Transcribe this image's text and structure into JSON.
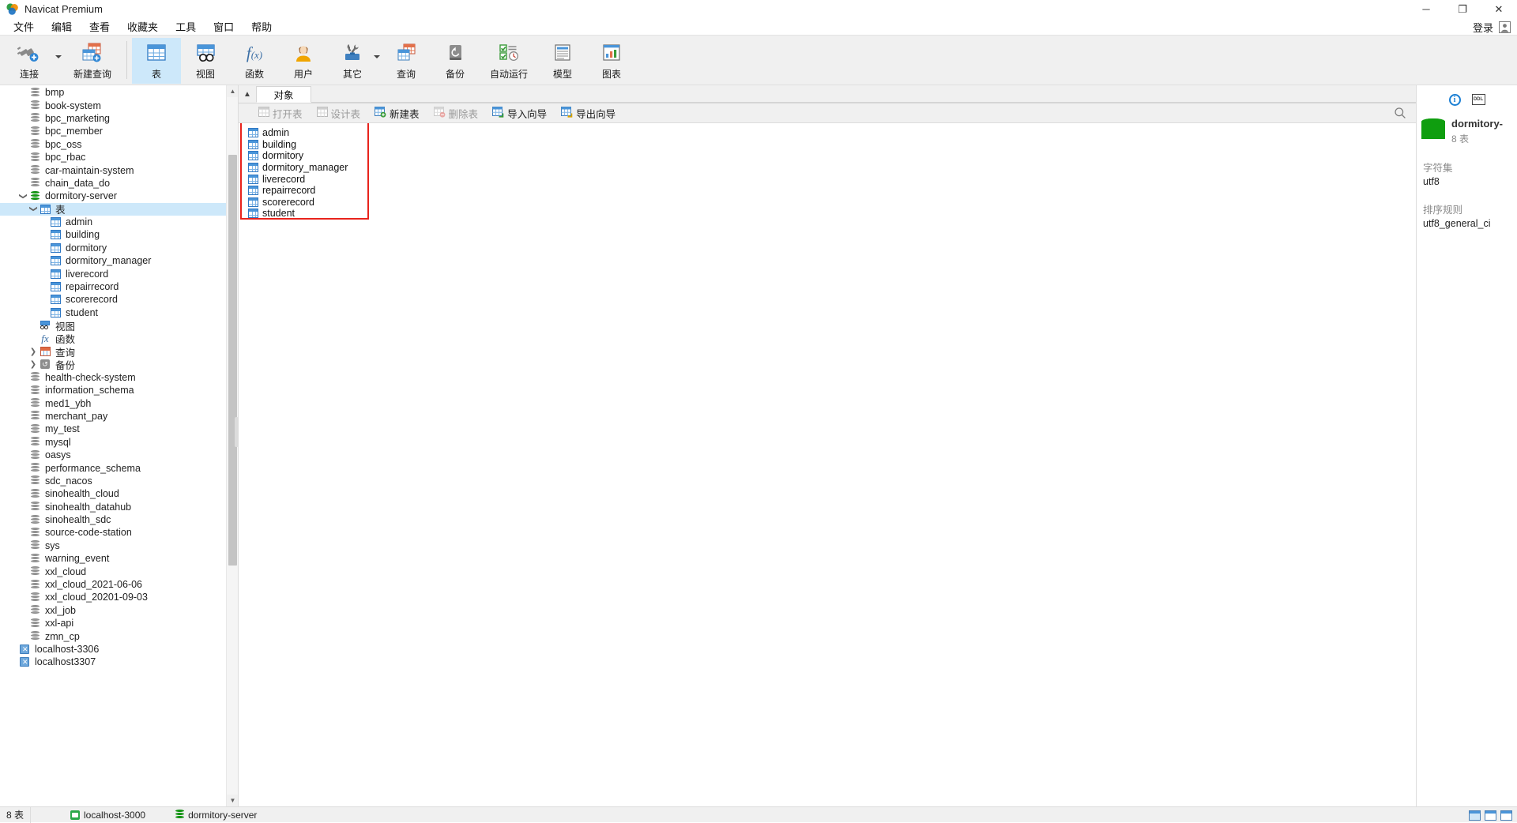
{
  "window": {
    "title": "Navicat Premium",
    "buttons": {
      "minimize": "─",
      "maximize": "❐",
      "close": "✕"
    }
  },
  "menu": {
    "items": [
      {
        "label": "文件"
      },
      {
        "label": "编辑"
      },
      {
        "label": "查看"
      },
      {
        "label": "收藏夹"
      },
      {
        "label": "工具"
      },
      {
        "label": "窗口"
      },
      {
        "label": "帮助"
      }
    ],
    "login_label": "登录"
  },
  "ribbon": {
    "items": [
      {
        "label": "连接",
        "icon": "connection-icon",
        "selected": false,
        "caret": true
      },
      {
        "label": "新建查询",
        "icon": "new-query-icon",
        "selected": false,
        "caret": false
      },
      {
        "label": "表",
        "icon": "table-icon",
        "selected": true,
        "caret": false
      },
      {
        "label": "视图",
        "icon": "view-icon",
        "selected": false,
        "caret": false
      },
      {
        "label": "函数",
        "icon": "function-icon",
        "selected": false,
        "caret": false
      },
      {
        "label": "用户",
        "icon": "user-icon",
        "selected": false,
        "caret": false
      },
      {
        "label": "其它",
        "icon": "other-tools-icon",
        "selected": false,
        "caret": true
      },
      {
        "label": "查询",
        "icon": "query-icon",
        "selected": false,
        "caret": false
      },
      {
        "label": "备份",
        "icon": "backup-icon",
        "selected": false,
        "caret": false
      },
      {
        "label": "自动运行",
        "icon": "automation-icon",
        "selected": false,
        "caret": false
      },
      {
        "label": "模型",
        "icon": "model-icon",
        "selected": false,
        "caret": false
      },
      {
        "label": "图表",
        "icon": "chart-icon",
        "selected": false,
        "caret": false
      }
    ]
  },
  "sidebar": {
    "nodes": [
      {
        "label": "bmp",
        "type": "db",
        "depth": 1,
        "arrow": "",
        "selected": false
      },
      {
        "label": "book-system",
        "type": "db",
        "depth": 1,
        "arrow": "",
        "selected": false
      },
      {
        "label": "bpc_marketing",
        "type": "db",
        "depth": 1,
        "arrow": "",
        "selected": false
      },
      {
        "label": "bpc_member",
        "type": "db",
        "depth": 1,
        "arrow": "",
        "selected": false
      },
      {
        "label": "bpc_oss",
        "type": "db",
        "depth": 1,
        "arrow": "",
        "selected": false
      },
      {
        "label": "bpc_rbac",
        "type": "db",
        "depth": 1,
        "arrow": "",
        "selected": false
      },
      {
        "label": "car-maintain-system",
        "type": "db",
        "depth": 1,
        "arrow": "",
        "selected": false
      },
      {
        "label": "chain_data_do",
        "type": "db",
        "depth": 1,
        "arrow": "",
        "selected": false
      },
      {
        "label": "dormitory-server",
        "type": "db-green",
        "depth": 1,
        "arrow": "v",
        "selected": false
      },
      {
        "label": "表",
        "type": "grid",
        "depth": 2,
        "arrow": "v",
        "selected": true
      },
      {
        "label": "admin",
        "type": "grid",
        "depth": 3,
        "arrow": "",
        "selected": false
      },
      {
        "label": "building",
        "type": "grid",
        "depth": 3,
        "arrow": "",
        "selected": false
      },
      {
        "label": "dormitory",
        "type": "grid",
        "depth": 3,
        "arrow": "",
        "selected": false
      },
      {
        "label": "dormitory_manager",
        "type": "grid",
        "depth": 3,
        "arrow": "",
        "selected": false
      },
      {
        "label": "liverecord",
        "type": "grid",
        "depth": 3,
        "arrow": "",
        "selected": false
      },
      {
        "label": "repairrecord",
        "type": "grid",
        "depth": 3,
        "arrow": "",
        "selected": false
      },
      {
        "label": "scorerecord",
        "type": "grid",
        "depth": 3,
        "arrow": "",
        "selected": false
      },
      {
        "label": "student",
        "type": "grid",
        "depth": 3,
        "arrow": "",
        "selected": false
      },
      {
        "label": "视图",
        "type": "view",
        "depth": 2,
        "arrow": "",
        "selected": false
      },
      {
        "label": "函数",
        "type": "fx",
        "depth": 2,
        "arrow": "",
        "selected": false
      },
      {
        "label": "查询",
        "type": "query",
        "depth": 2,
        "arrow": ">",
        "selected": false
      },
      {
        "label": "备份",
        "type": "backup",
        "depth": 2,
        "arrow": ">",
        "selected": false
      },
      {
        "label": "health-check-system",
        "type": "db",
        "depth": 1,
        "arrow": "",
        "selected": false
      },
      {
        "label": "information_schema",
        "type": "db",
        "depth": 1,
        "arrow": "",
        "selected": false
      },
      {
        "label": "med1_ybh",
        "type": "db",
        "depth": 1,
        "arrow": "",
        "selected": false
      },
      {
        "label": "merchant_pay",
        "type": "db",
        "depth": 1,
        "arrow": "",
        "selected": false
      },
      {
        "label": "my_test",
        "type": "db",
        "depth": 1,
        "arrow": "",
        "selected": false
      },
      {
        "label": "mysql",
        "type": "db",
        "depth": 1,
        "arrow": "",
        "selected": false
      },
      {
        "label": "oasys",
        "type": "db",
        "depth": 1,
        "arrow": "",
        "selected": false
      },
      {
        "label": "performance_schema",
        "type": "db",
        "depth": 1,
        "arrow": "",
        "selected": false
      },
      {
        "label": "sdc_nacos",
        "type": "db",
        "depth": 1,
        "arrow": "",
        "selected": false
      },
      {
        "label": "sinohealth_cloud",
        "type": "db",
        "depth": 1,
        "arrow": "",
        "selected": false
      },
      {
        "label": "sinohealth_datahub",
        "type": "db",
        "depth": 1,
        "arrow": "",
        "selected": false
      },
      {
        "label": "sinohealth_sdc",
        "type": "db",
        "depth": 1,
        "arrow": "",
        "selected": false
      },
      {
        "label": "source-code-station",
        "type": "db",
        "depth": 1,
        "arrow": "",
        "selected": false
      },
      {
        "label": "sys",
        "type": "db",
        "depth": 1,
        "arrow": "",
        "selected": false
      },
      {
        "label": "warning_event",
        "type": "db",
        "depth": 1,
        "arrow": "",
        "selected": false
      },
      {
        "label": "xxl_cloud",
        "type": "db",
        "depth": 1,
        "arrow": "",
        "selected": false
      },
      {
        "label": "xxl_cloud_2021-06-06",
        "type": "db",
        "depth": 1,
        "arrow": "",
        "selected": false
      },
      {
        "label": "xxl_cloud_20201-09-03",
        "type": "db",
        "depth": 1,
        "arrow": "",
        "selected": false
      },
      {
        "label": "xxl_job",
        "type": "db",
        "depth": 1,
        "arrow": "",
        "selected": false
      },
      {
        "label": "xxl-api",
        "type": "db",
        "depth": 1,
        "arrow": "",
        "selected": false
      },
      {
        "label": "zmn_cp",
        "type": "db",
        "depth": 1,
        "arrow": "",
        "selected": false
      },
      {
        "label": "localhost-3306",
        "type": "conn",
        "depth": 0,
        "arrow": "",
        "selected": false
      },
      {
        "label": "localhost3307",
        "type": "conn",
        "depth": 0,
        "arrow": "",
        "selected": false
      }
    ]
  },
  "main": {
    "tab": {
      "label": "对象",
      "collapse_icon": "chevron-up-icon"
    },
    "object_toolbar": [
      {
        "label": "打开表",
        "icon": "open-table-icon",
        "enabled": false
      },
      {
        "label": "设计表",
        "icon": "design-table-icon",
        "enabled": false
      },
      {
        "label": "新建表",
        "icon": "new-table-icon",
        "enabled": true
      },
      {
        "label": "删除表",
        "icon": "delete-table-icon",
        "enabled": false
      },
      {
        "label": "导入向导",
        "icon": "import-wizard-icon",
        "enabled": true
      },
      {
        "label": "导出向导",
        "icon": "export-wizard-icon",
        "enabled": true
      }
    ],
    "search_icon": "search-icon",
    "tables": [
      {
        "name": "admin"
      },
      {
        "name": "building"
      },
      {
        "name": "dormitory"
      },
      {
        "name": "dormitory_manager"
      },
      {
        "name": "liverecord"
      },
      {
        "name": "repairrecord"
      },
      {
        "name": "scorerecord"
      },
      {
        "name": "student"
      }
    ],
    "highlight_color": "#e8231c"
  },
  "info_panel": {
    "tabs": [
      {
        "name": "info-tab",
        "label": "i"
      },
      {
        "name": "ddl-tab",
        "label": "DDL"
      }
    ],
    "db_name": "dormitory-",
    "db_count": "8 表",
    "sections": [
      {
        "label": "字符集",
        "value": "utf8"
      },
      {
        "label": "排序规则",
        "value": "utf8_general_ci"
      }
    ]
  },
  "statusbar": {
    "table_count": "8 表",
    "connection": "localhost-3000",
    "database": "dormitory-server",
    "view_modes": [
      "grid-view-icon",
      "form-view-icon",
      "detail-view-icon"
    ]
  }
}
